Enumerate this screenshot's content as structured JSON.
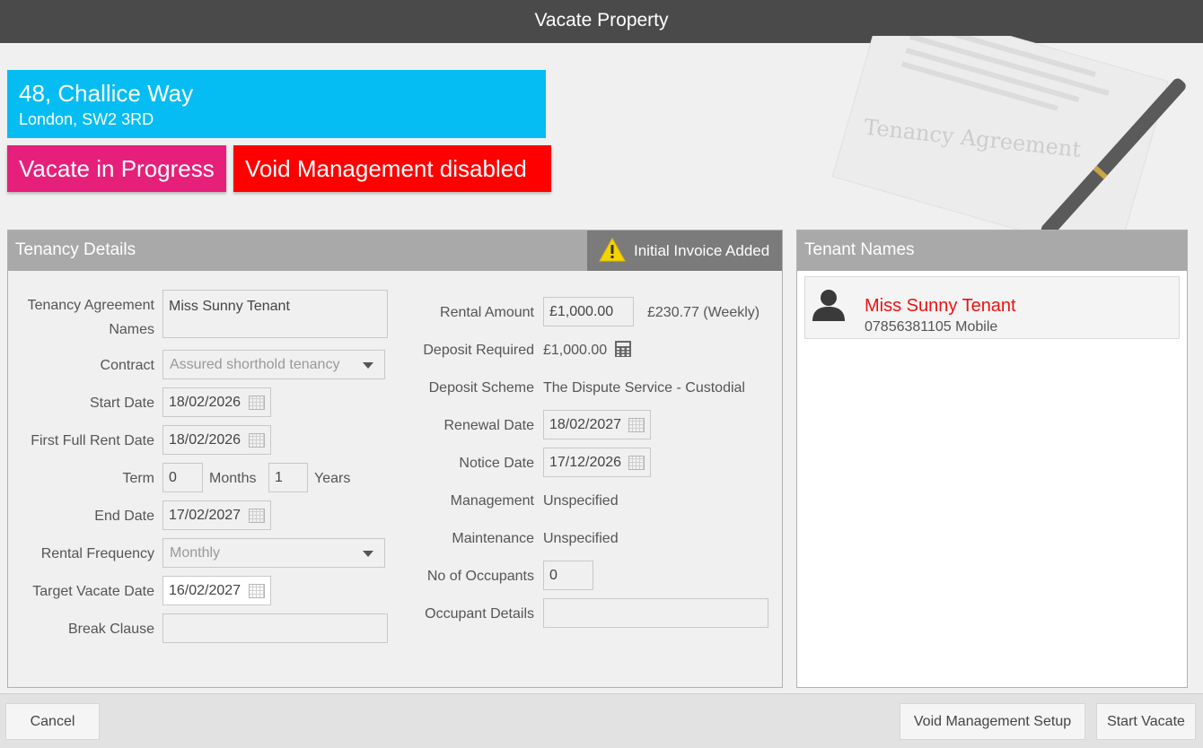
{
  "window": {
    "title": "Vacate Property"
  },
  "property": {
    "line1": "48, Challice Way",
    "line2": "London, SW2 3RD"
  },
  "badges": {
    "vacate": "Vacate in Progress",
    "void": "Void Management disabled"
  },
  "colors": {
    "header": "#4a4a4a",
    "address": "#05bdf3",
    "vacate_badge": "#e6207a",
    "void_badge": "#ff0000",
    "tenant_name": "#ee1111"
  },
  "tenancy": {
    "header": "Tenancy Details",
    "invoice_tag": "Initial Invoice Added",
    "labels": {
      "agreement_names_1": "Tenancy Agreement",
      "agreement_names_2": "Names",
      "contract": "Contract",
      "start_date": "Start Date",
      "first_full_rent": "First Full Rent Date",
      "term": "Term",
      "months": "Months",
      "years": "Years",
      "end_date": "End Date",
      "rental_frequency": "Rental Frequency",
      "target_vacate": "Target Vacate Date",
      "break_clause": "Break Clause",
      "rental_amount": "Rental Amount",
      "deposit_required": "Deposit Required",
      "deposit_scheme": "Deposit Scheme",
      "renewal_date": "Renewal Date",
      "notice_date": "Notice Date",
      "management": "Management",
      "maintenance": "Maintenance",
      "occupants": "No of Occupants",
      "occupant_details": "Occupant Details"
    },
    "values": {
      "agreement_names": "Miss Sunny Tenant",
      "contract": "Assured shorthold tenancy",
      "start_date": "18/02/2026",
      "first_full_rent": "18/02/2026",
      "term_months": "0",
      "term_years": "1",
      "end_date": "17/02/2027",
      "rental_frequency": "Monthly",
      "target_vacate": "16/02/2027",
      "break_clause": "",
      "rental_amount": "£1,000.00",
      "weekly": "£230.77 (Weekly)",
      "deposit_required": "£1,000.00",
      "deposit_scheme": "The Dispute Service - Custodial",
      "renewal_date": "18/02/2027",
      "notice_date": "17/12/2026",
      "management": "Unspecified",
      "maintenance": "Unspecified",
      "occupants": "0",
      "occupant_details": ""
    }
  },
  "tenants": {
    "header": "Tenant Names",
    "items": [
      {
        "name": "Miss Sunny Tenant",
        "phone": "07856381105 Mobile"
      }
    ]
  },
  "footer": {
    "cancel": "Cancel",
    "void_setup": "Void Management Setup",
    "start_vacate": "Start Vacate"
  },
  "icons": {
    "warning": "warning-icon",
    "calendar": "calendar-icon",
    "calculator": "calculator-icon",
    "person": "person-icon",
    "dropdown": "chevron-down-icon"
  }
}
